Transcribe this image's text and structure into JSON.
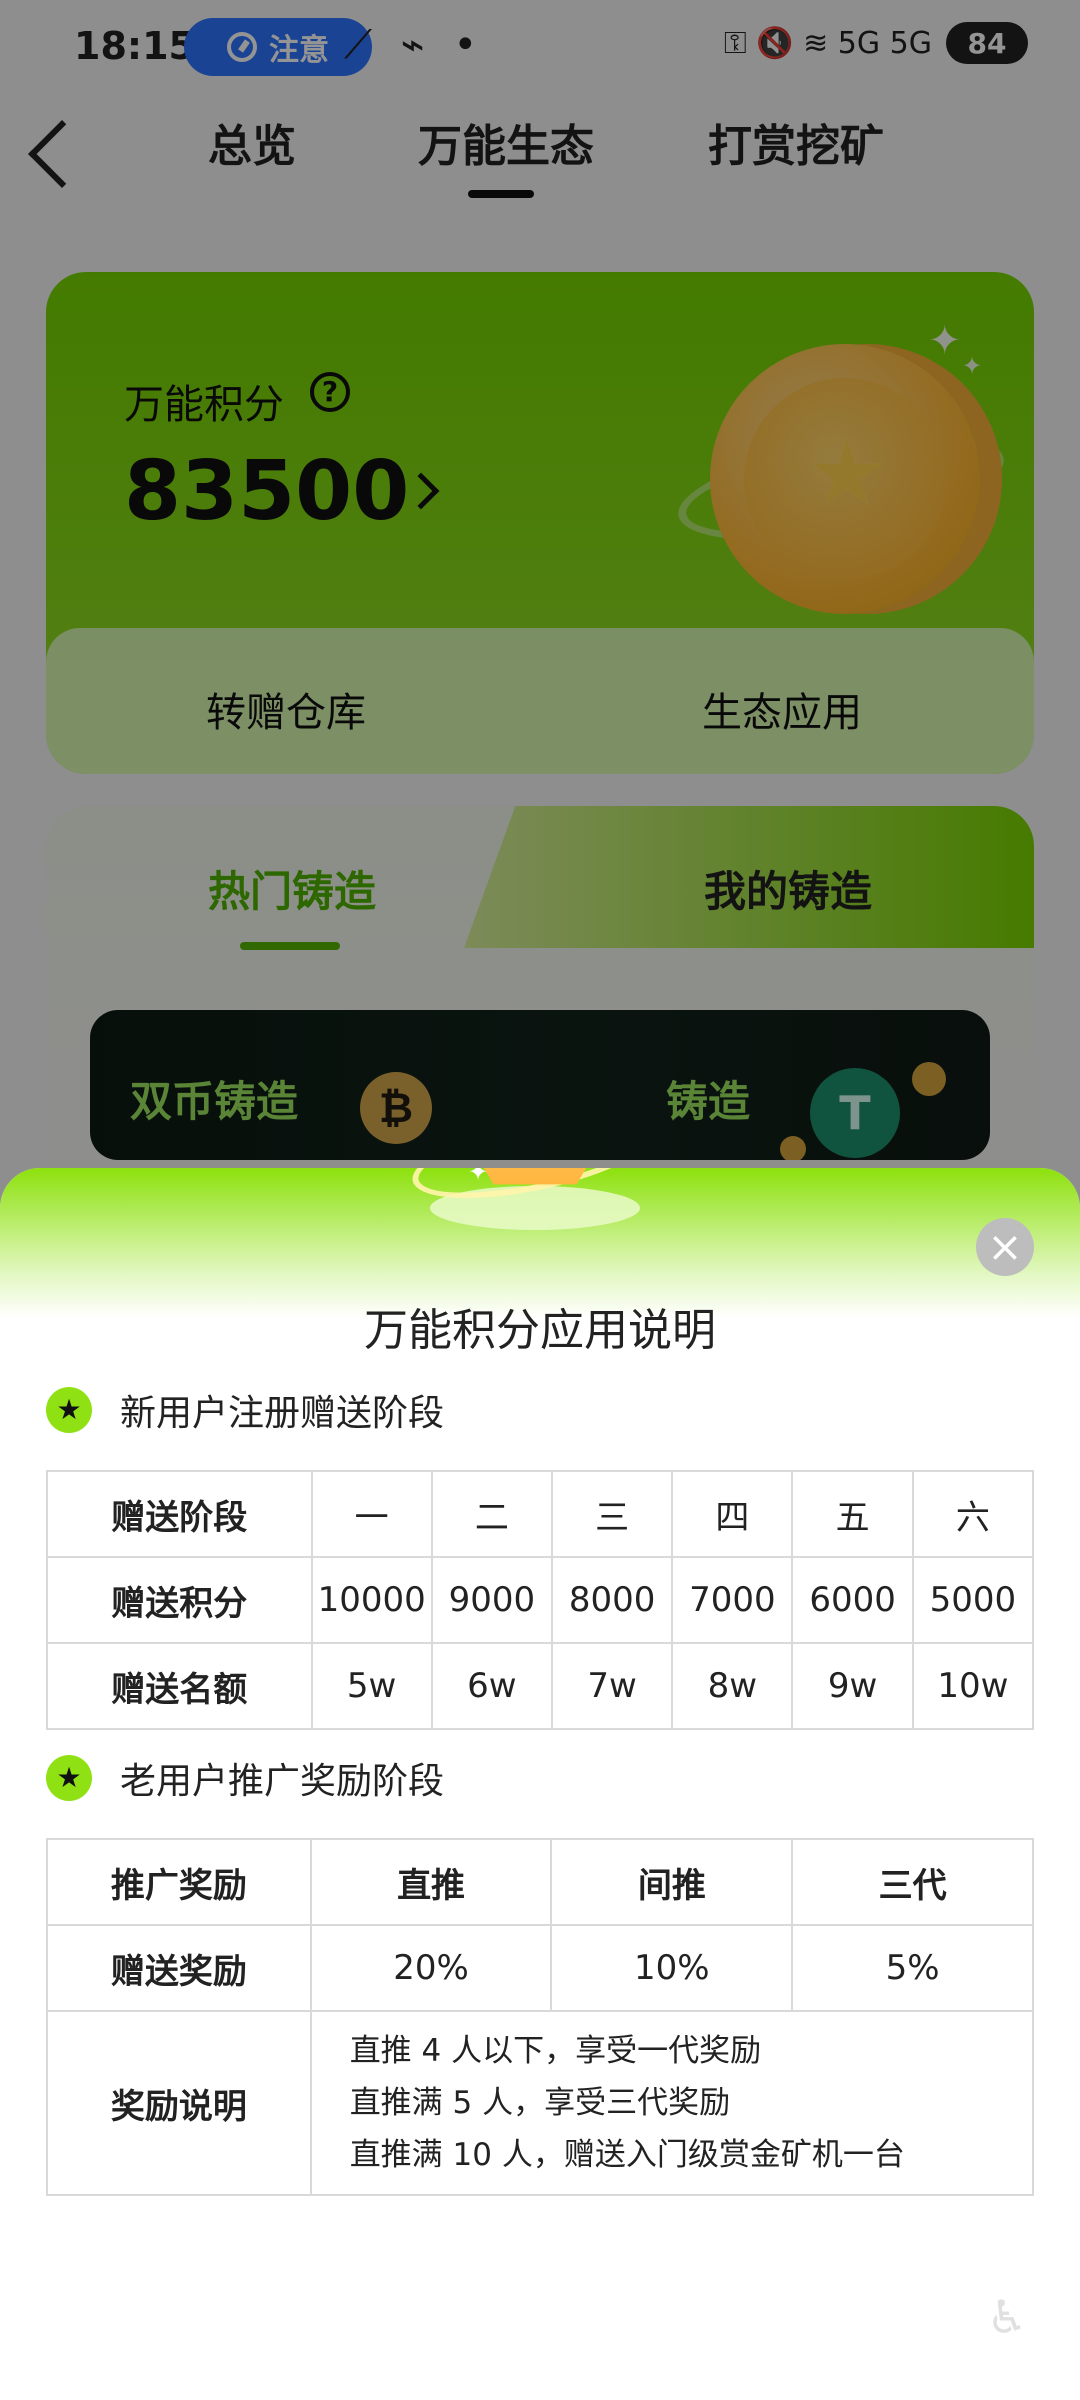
{
  "status_bar": {
    "time": "18:15",
    "notice": "注意",
    "misc": "⟋ ⌁ •",
    "right_icons": "⚿ 🔇 ≋ 5G 5G",
    "battery": "84"
  },
  "top_nav": {
    "back": "back",
    "tabs": [
      "总览",
      "万能生态",
      "打赏挖矿"
    ]
  },
  "points_card": {
    "label": "万能积分",
    "help": "?",
    "value": "83500",
    "actions": [
      "转赠仓库",
      "生态应用"
    ]
  },
  "mint_section": {
    "tabs": [
      "热门铸造",
      "我的铸造"
    ],
    "banner_left": "双币铸造",
    "banner_right": "铸造",
    "coin_left": "₿",
    "coin_right": "T"
  },
  "modal": {
    "title": "万能积分应用说明",
    "close": "×",
    "new_user_title": "新用户注册赠送阶段",
    "new_user_table": {
      "stage_label": "赠送阶段",
      "stages": [
        "一",
        "二",
        "三",
        "四",
        "五",
        "六"
      ],
      "points_label": "赠送积分",
      "points": [
        "10000",
        "9000",
        "8000",
        "7000",
        "6000",
        "5000"
      ],
      "quota_label": "赠送名额",
      "quotas": [
        "5w",
        "6w",
        "7w",
        "8w",
        "9w",
        "10w"
      ]
    },
    "old_user_title": "老用户推广奖励阶段",
    "old_user_table": {
      "reward_label": "推广奖励",
      "reward_types": [
        "直推",
        "间推",
        "三代"
      ],
      "gift_label": "赠送奖励",
      "gift_values": [
        "20%",
        "10%",
        "5%"
      ],
      "notes_label": "奖励说明",
      "notes": [
        "直推 4 人以下，享受一代奖励",
        "直推满 5 人，享受三代奖励",
        "直推满 10 人，赠送入门级赏金矿机一台"
      ]
    }
  },
  "icons": {
    "accessibility": "accessibility-icon"
  }
}
